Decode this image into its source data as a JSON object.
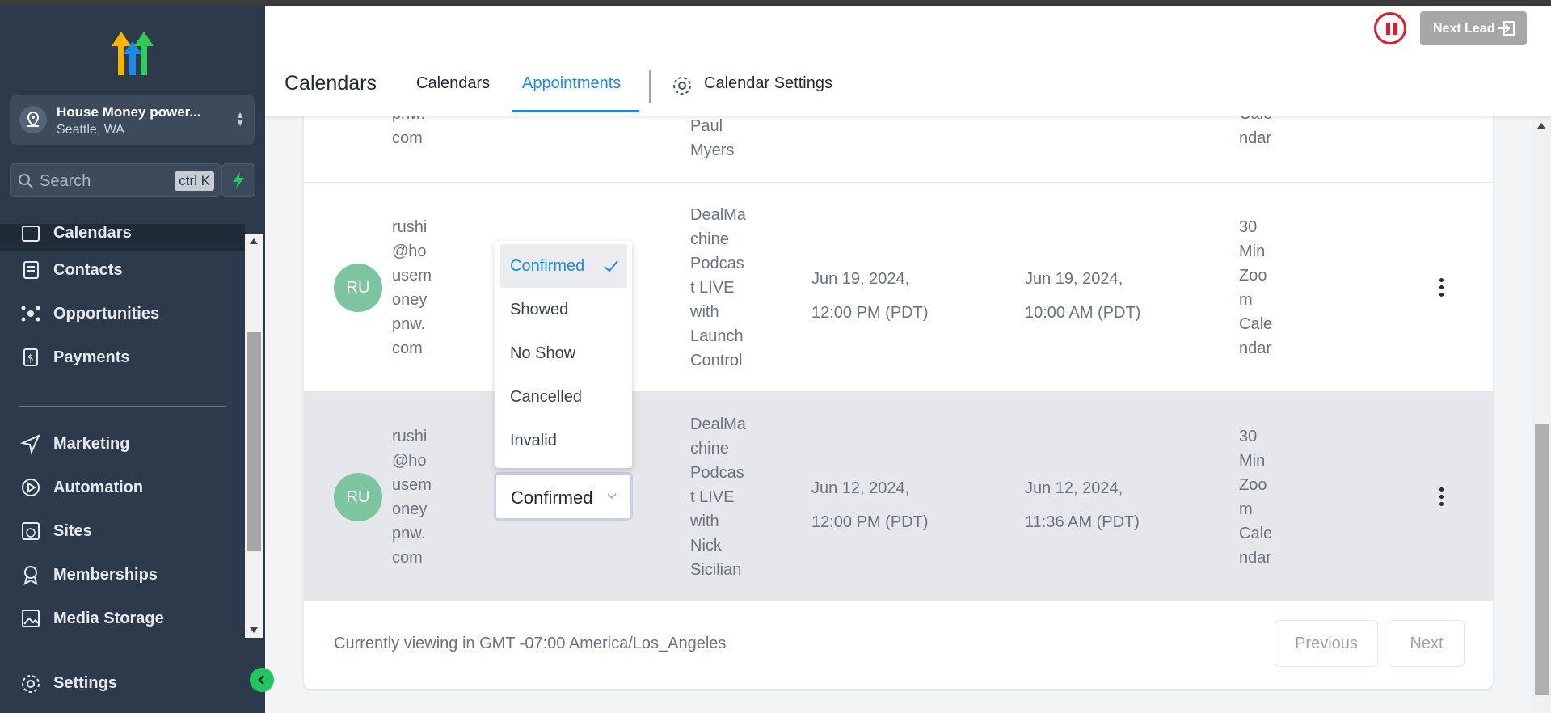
{
  "sidebar": {
    "location": {
      "name": "House Money power...",
      "city": "Seattle, WA"
    },
    "search": {
      "placeholder": "Search",
      "shortcut": "ctrl K"
    },
    "items": [
      {
        "label": "Calendars",
        "icon": "calendar-icon"
      },
      {
        "label": "Contacts",
        "icon": "contacts-icon"
      },
      {
        "label": "Opportunities",
        "icon": "opportunities-icon"
      },
      {
        "label": "Payments",
        "icon": "payments-icon"
      },
      {
        "label": "Marketing",
        "icon": "send-icon"
      },
      {
        "label": "Automation",
        "icon": "play-circle-icon"
      },
      {
        "label": "Sites",
        "icon": "globe-icon"
      },
      {
        "label": "Memberships",
        "icon": "badge-icon"
      },
      {
        "label": "Media Storage",
        "icon": "image-icon"
      }
    ],
    "settings_label": "Settings"
  },
  "header": {
    "next_lead_label": "Next Lead",
    "page_title": "Calendars",
    "tabs": [
      {
        "label": "Calendars"
      },
      {
        "label": "Appointments"
      },
      {
        "label": "Calendar Settings"
      }
    ],
    "active_tab": "Appointments"
  },
  "table": {
    "rows": [
      {
        "email": [
          "pnw.",
          "com"
        ],
        "title": [
          "Paul",
          "Myers"
        ],
        "calendar": [
          "Cale",
          "ndar"
        ]
      },
      {
        "avatar": "RU",
        "email": [
          "rushi",
          "@ho",
          "usem",
          "oney",
          "pnw.",
          "com"
        ],
        "title": [
          "DealMa",
          "chine",
          "Podcas",
          "t LIVE",
          "with",
          "Launch",
          "Control"
        ],
        "date_requested": [
          "Jun 19, 2024,",
          "12:00 PM (PDT)"
        ],
        "date_created": [
          "Jun 19, 2024,",
          "10:00 AM (PDT)"
        ],
        "calendar": [
          "30",
          "Min",
          "Zoo",
          "m",
          "Cale",
          "ndar"
        ]
      },
      {
        "avatar": "RU",
        "email": [
          "rushi",
          "@ho",
          "usem",
          "oney",
          "pnw.",
          "com"
        ],
        "status": "Confirmed",
        "title": [
          "DealMa",
          "chine",
          "Podcas",
          "t LIVE",
          "with",
          "Nick",
          "Sicilian"
        ],
        "date_requested": [
          "Jun 12, 2024,",
          "12:00 PM (PDT)"
        ],
        "date_created": [
          "Jun 12, 2024,",
          "11:36 AM (PDT)"
        ],
        "calendar": [
          "30",
          "Min",
          "Zoo",
          "m",
          "Cale",
          "ndar"
        ]
      }
    ],
    "status_options": [
      "Confirmed",
      "Showed",
      "No Show",
      "Cancelled",
      "Invalid"
    ],
    "selected_status": "Confirmed"
  },
  "footer": {
    "timezone_note": "Currently viewing in GMT -07:00 America/Los_Angeles",
    "previous_label": "Previous",
    "next_label": "Next"
  },
  "colors": {
    "accent": "#1e88e5",
    "sidebar": "#2d3a4b",
    "avatar": "#7cc5a0",
    "pause": "#e11d2a"
  }
}
